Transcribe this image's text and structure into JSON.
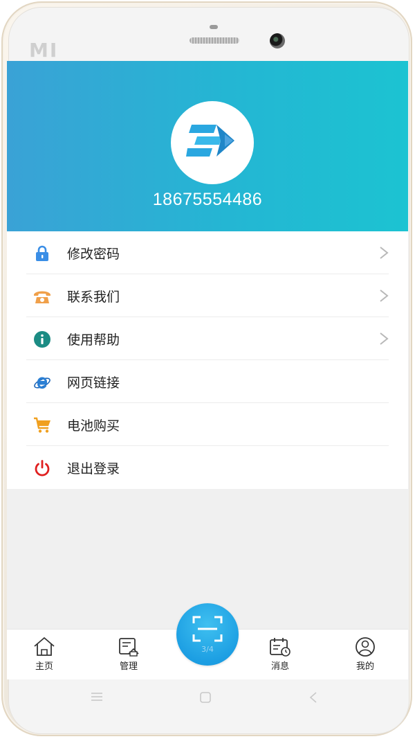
{
  "device": {
    "brand_logo": "MI"
  },
  "profile": {
    "phone_number": "18675554486",
    "avatar_icon": "arrow-logo-icon"
  },
  "menu": {
    "items": [
      {
        "label": "修改密码",
        "icon": "lock-icon",
        "icon_color": "#3a8ee6",
        "chevron": true
      },
      {
        "label": "联系我们",
        "icon": "telephone-icon",
        "icon_color": "#f0a04a",
        "chevron": true
      },
      {
        "label": "使用帮助",
        "icon": "info-icon",
        "icon_color": "#1c8c84",
        "chevron": true
      },
      {
        "label": "网页链接",
        "icon": "browser-e-icon",
        "icon_color": "#2a7fd4",
        "chevron": false
      },
      {
        "label": "电池购买",
        "icon": "shopping-cart-icon",
        "icon_color": "#f0a020",
        "chevron": false
      },
      {
        "label": "退出登录",
        "icon": "power-icon",
        "icon_color": "#e02020",
        "chevron": false
      }
    ]
  },
  "tabbar": {
    "tabs": [
      {
        "label": "主页",
        "icon": "home-icon"
      },
      {
        "label": "管理",
        "icon": "manage-icon"
      },
      {
        "label": "消息",
        "icon": "calendar-clock-icon"
      },
      {
        "label": "我的",
        "icon": "user-icon"
      }
    ],
    "scan": {
      "icon": "scan-icon",
      "caption": "3/4"
    }
  },
  "colors": {
    "header_start": "#3aa2d6",
    "header_end": "#1cc3d2",
    "scan_button": "#1d9fe3"
  }
}
